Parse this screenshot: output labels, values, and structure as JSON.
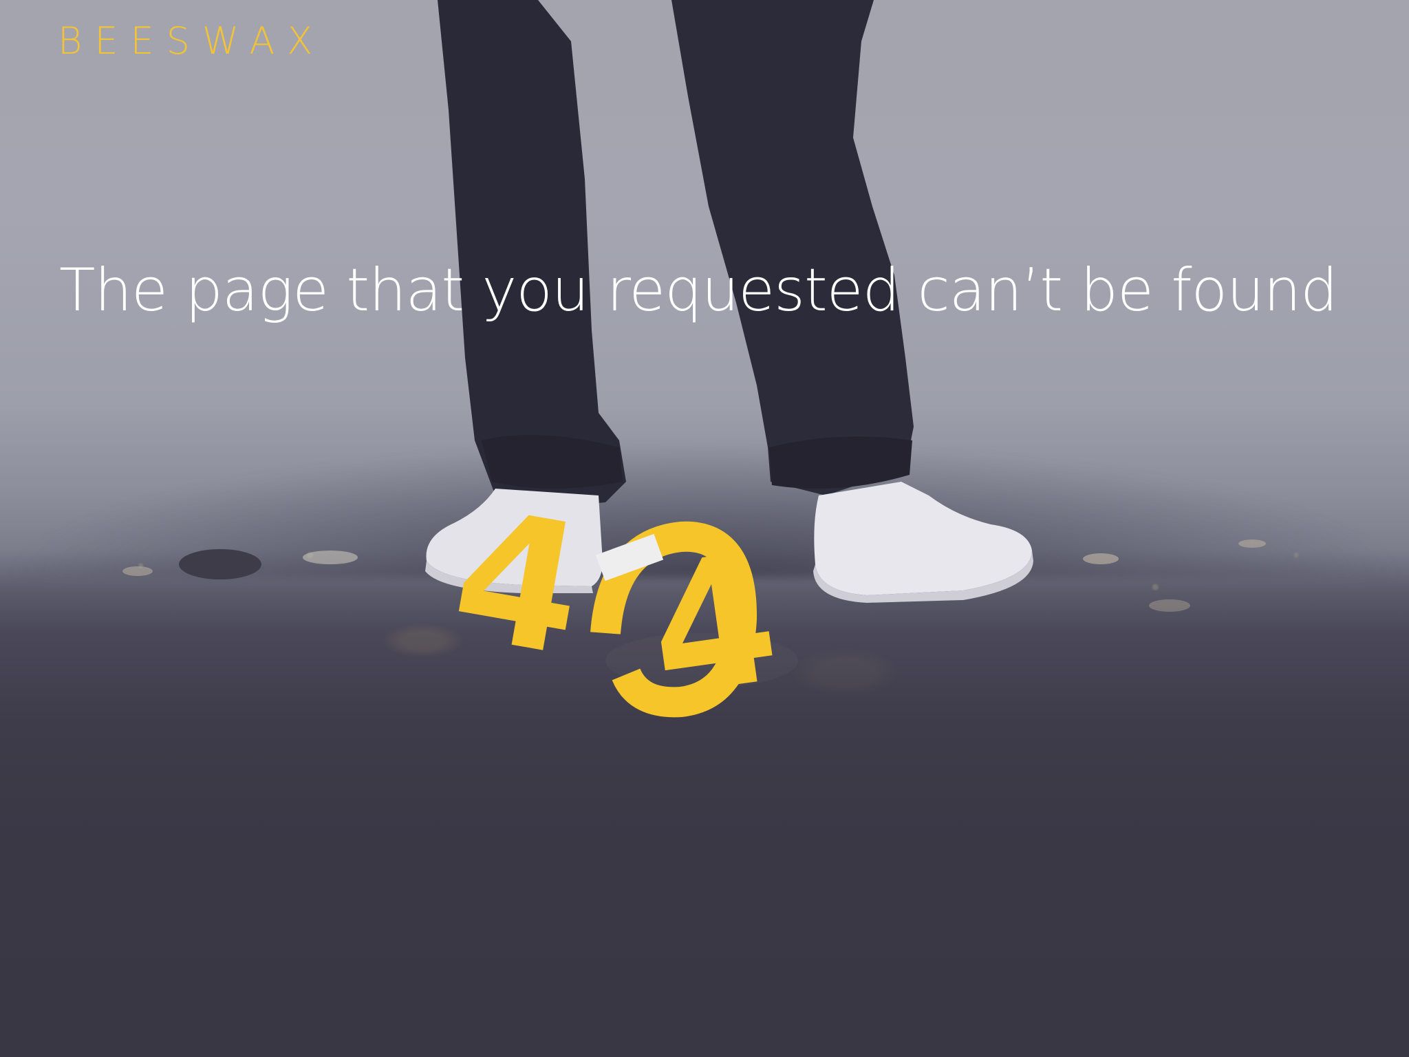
{
  "brand": {
    "logo_text": "BEESWAX"
  },
  "error": {
    "message": "The page that you requested can’t be found",
    "code": "404"
  },
  "colors": {
    "accent": "#f2c237",
    "text": "#ffffff",
    "sky": "#a3a4ae",
    "ground": "#393744"
  }
}
